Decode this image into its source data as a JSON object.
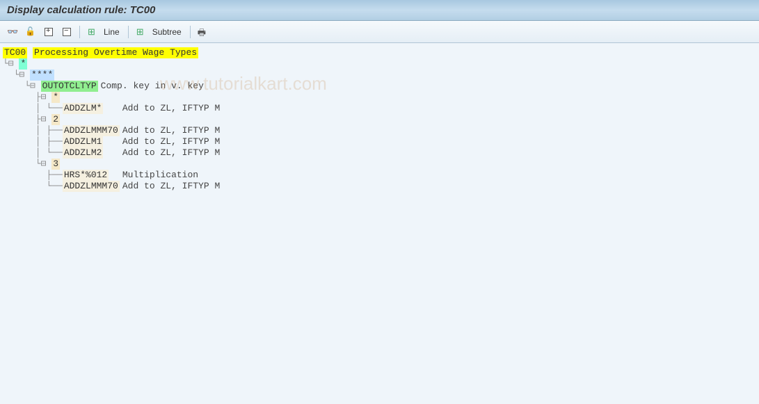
{
  "title": "Display calculation rule: TC00",
  "toolbar": {
    "line_label": "Line",
    "subtree_label": "Subtree"
  },
  "watermark": "www.tutorialkart.com",
  "tree": {
    "root_code": "TC00",
    "root_desc": "Processing Overtime Wage Types",
    "l1_star": "*",
    "l2_stars": "****",
    "l3_code": "OUTOTCLTYP",
    "l3_desc": "Comp. key in v. key",
    "g1_key": "*",
    "g1_item1_code": "ADDZLM*",
    "g1_item1_desc": "Add to ZL, IFTYP M",
    "g2_key": "2",
    "g2_item1_code": "ADDZLMMM70",
    "g2_item1_desc": "Add to ZL, IFTYP M",
    "g2_item2_code": "ADDZLM1",
    "g2_item2_desc": "Add to ZL, IFTYP M",
    "g2_item3_code": "ADDZLM2",
    "g2_item3_desc": "Add to ZL, IFTYP M",
    "g3_key": "3",
    "g3_item1_code": "HRS*%012",
    "g3_item1_desc": "Multiplication",
    "g3_item2_code": "ADDZLMMM70",
    "g3_item2_desc": "Add to ZL, IFTYP M"
  }
}
